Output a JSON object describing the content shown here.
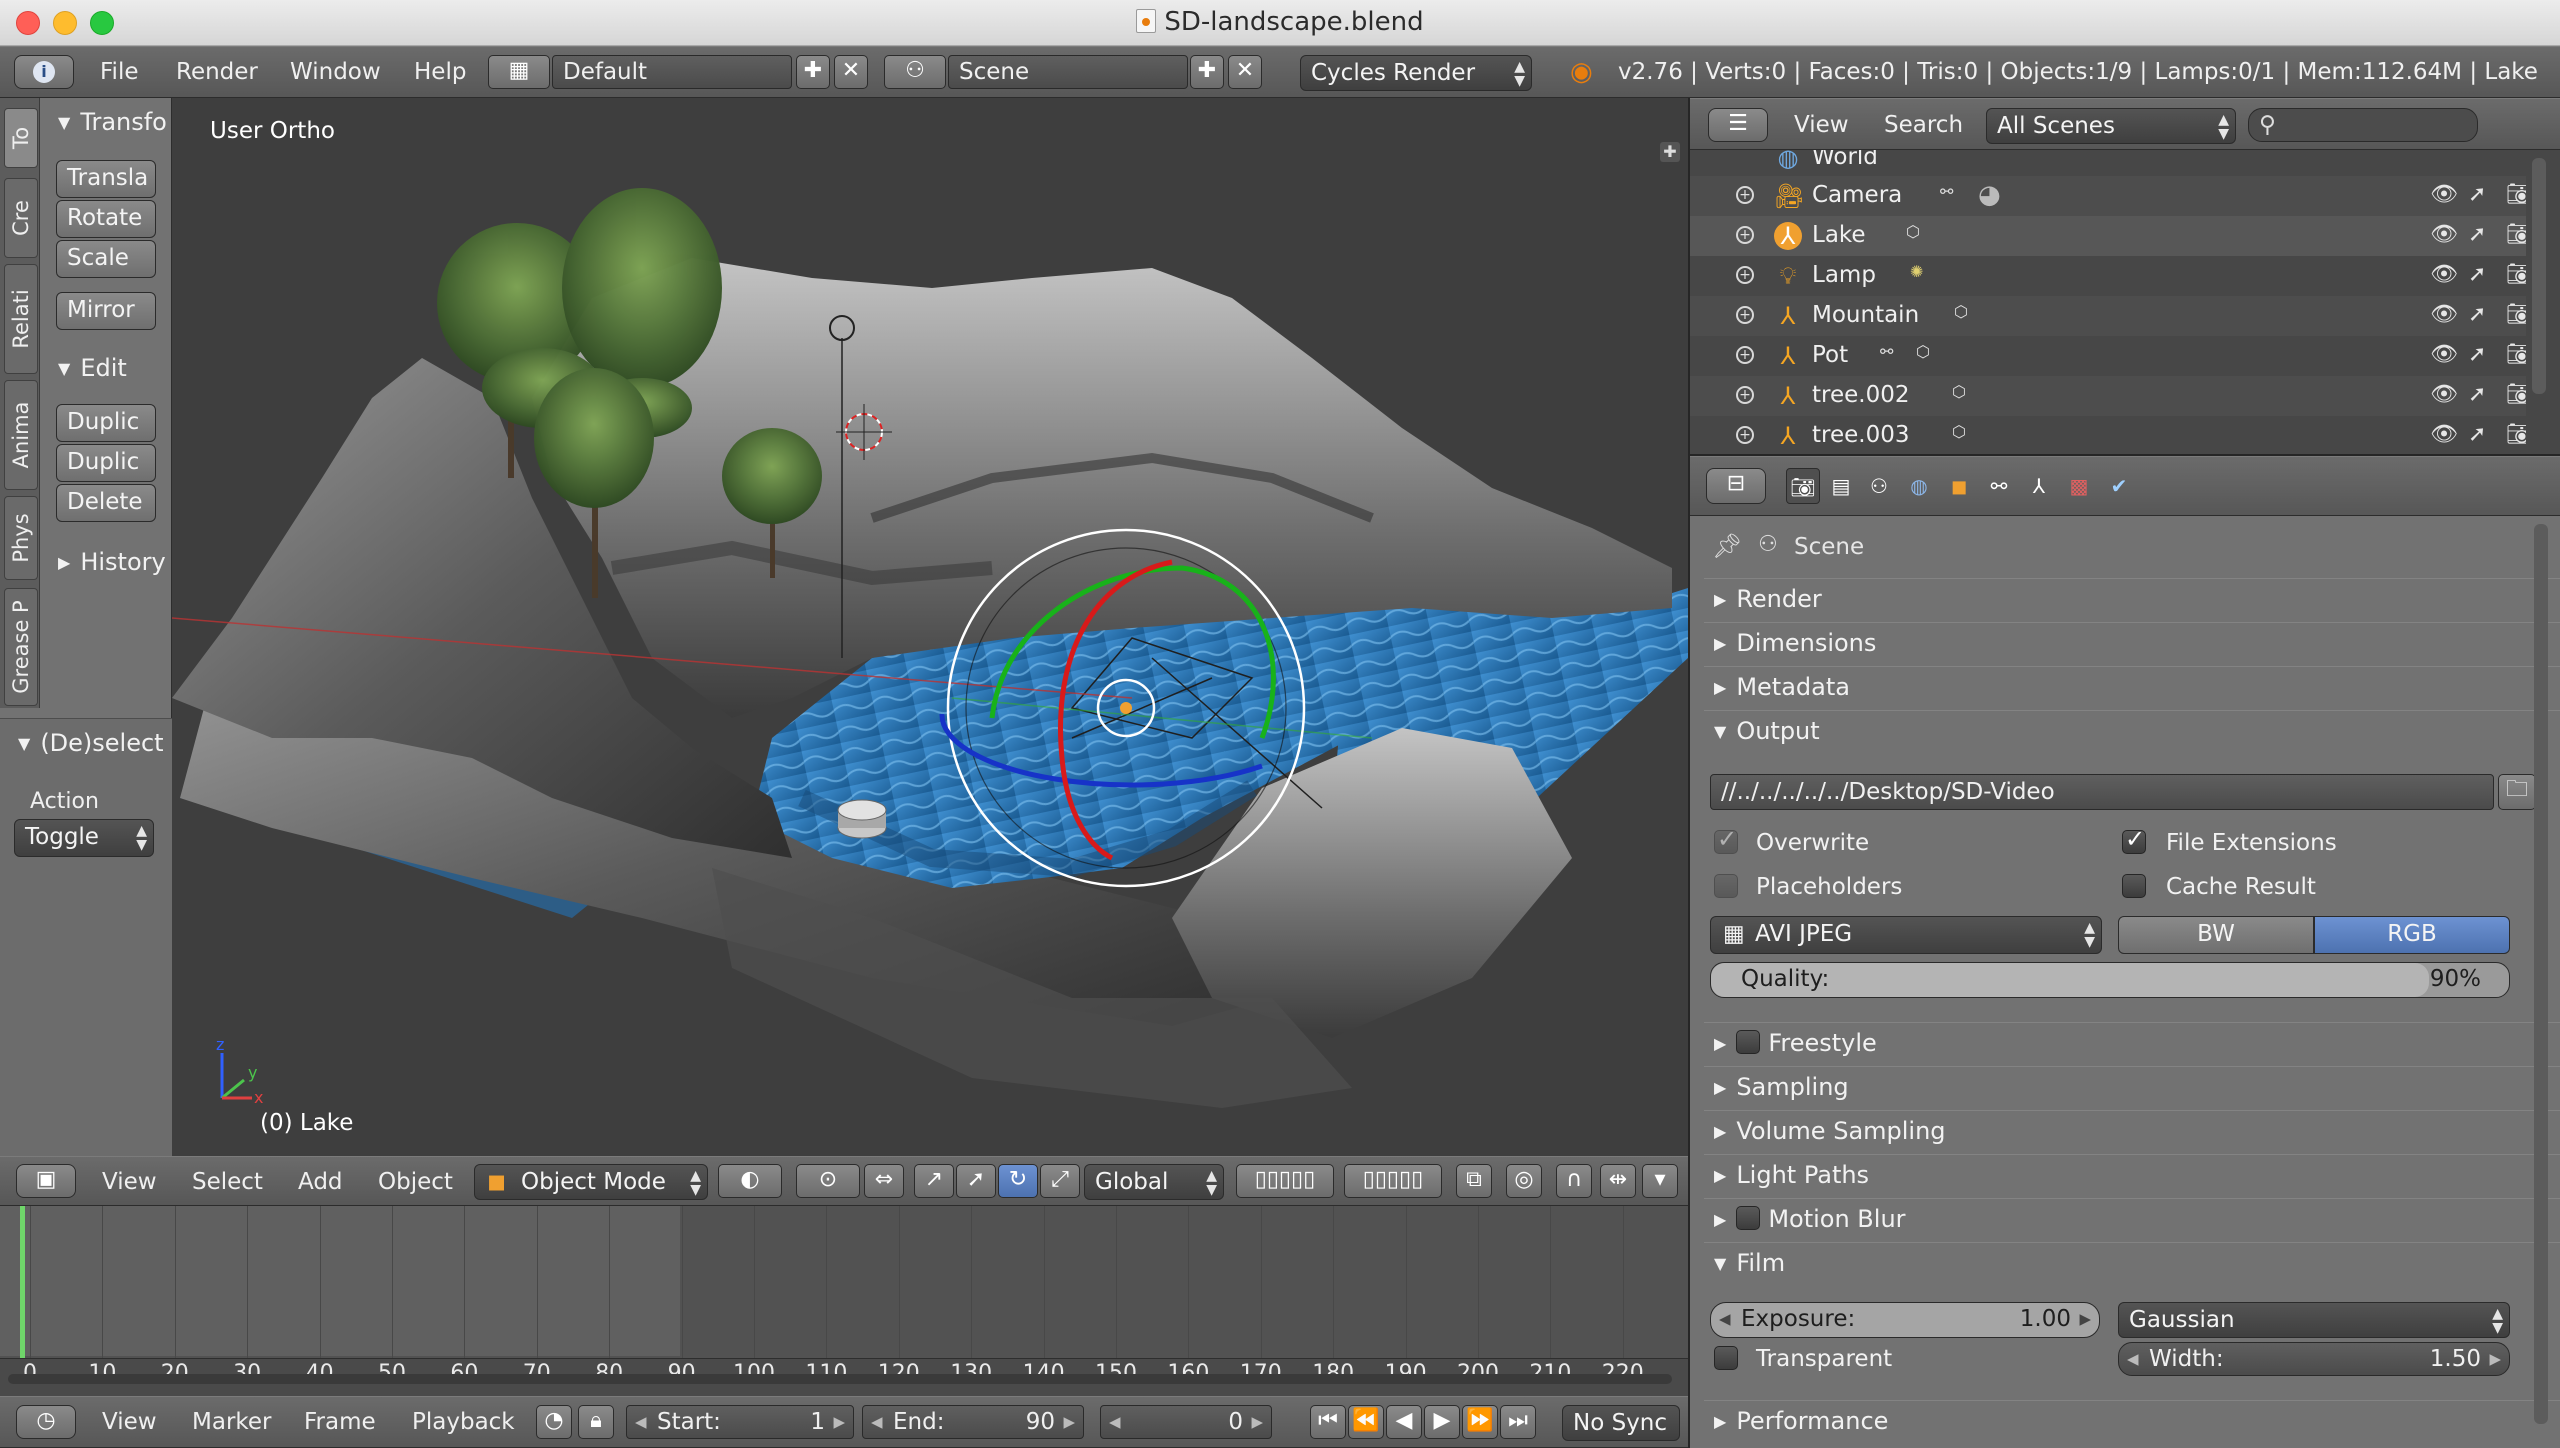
{
  "window": {
    "title": "SD-landscape.blend"
  },
  "info_header": {
    "menus": [
      "File",
      "Render",
      "Window",
      "Help"
    ],
    "layout": "Default",
    "scene": "Scene",
    "engine": "Cycles Render",
    "stats": "v2.76 | Verts:0 | Faces:0 | Tris:0 | Objects:1/9 | Lamps:0/1 | Mem:112.64M | Lake"
  },
  "tool_shelf": {
    "tabs": [
      "To",
      "Cre",
      "Relati",
      "Anima",
      "Phys",
      "Grease P"
    ],
    "transform": {
      "title": "Transfo",
      "buttons": [
        "Transla",
        "Rotate",
        "Scale"
      ],
      "mirror": "Mirror"
    },
    "edit": {
      "title": "Edit",
      "buttons": [
        "Duplic",
        "Duplic",
        "Delete"
      ]
    },
    "history": "History",
    "deselect": {
      "title": "(De)select",
      "action_label": "Action",
      "action_value": "Toggle"
    }
  },
  "viewport": {
    "view_label": "User Ortho",
    "object_label": "(0) Lake",
    "axis_labels": {
      "x": "x",
      "y": "y",
      "z": "z"
    }
  },
  "view_header": {
    "menus": [
      "View",
      "Select",
      "Add",
      "Object"
    ],
    "mode": "Object Mode",
    "orientation": "Global"
  },
  "timeline": {
    "ticks": [
      "0",
      "10",
      "20",
      "30",
      "40",
      "50",
      "60",
      "70",
      "80",
      "90",
      "100",
      "110",
      "120",
      "130",
      "140",
      "150",
      "160",
      "170",
      "180",
      "190",
      "200",
      "210",
      "220"
    ],
    "menus": [
      "View",
      "Marker",
      "Frame",
      "Playback"
    ],
    "start_label": "Start:",
    "start": "1",
    "end_label": "End:",
    "end": "90",
    "current": "0",
    "sync": "No Sync"
  },
  "outliner": {
    "menus": [
      "View",
      "Search"
    ],
    "filter": "All Scenes",
    "search_placeholder": "",
    "rows": [
      {
        "name": "World",
        "icon": "world-icon"
      },
      {
        "name": "Camera",
        "icon": "camera-icon"
      },
      {
        "name": "Lake",
        "icon": "empty-object-icon"
      },
      {
        "name": "Lamp",
        "icon": "lamp-icon"
      },
      {
        "name": "Mountain",
        "icon": "empty-object-icon"
      },
      {
        "name": "Pot",
        "icon": "empty-object-icon"
      },
      {
        "name": "tree.002",
        "icon": "empty-object-icon"
      },
      {
        "name": "tree.003",
        "icon": "empty-object-icon"
      }
    ]
  },
  "properties": {
    "context": "Scene",
    "sections": {
      "render": "Render",
      "dimensions": "Dimensions",
      "metadata": "Metadata",
      "output": "Output",
      "freestyle": "Freestyle",
      "sampling": "Sampling",
      "volume_sampling": "Volume Sampling",
      "light_paths": "Light Paths",
      "motion_blur": "Motion Blur",
      "film": "Film",
      "performance": "Performance"
    },
    "output": {
      "path": "//../../../../../Desktop/SD-Video",
      "overwrite": "Overwrite",
      "file_extensions": "File Extensions",
      "placeholders": "Placeholders",
      "cache_result": "Cache Result",
      "format": "AVI JPEG",
      "bw": "BW",
      "rgb": "RGB",
      "quality_label": "Quality:",
      "quality": "90%",
      "quality_value": 0.9
    },
    "film": {
      "exposure_label": "Exposure:",
      "exposure": "1.00",
      "filter": "Gaussian",
      "transparent": "Transparent",
      "width_label": "Width:",
      "width": "1.50"
    }
  },
  "colors": {
    "accent_blue": "#5680c2",
    "timeline_cursor": "#6fd56a",
    "brand_orange": "#e87d0d"
  }
}
